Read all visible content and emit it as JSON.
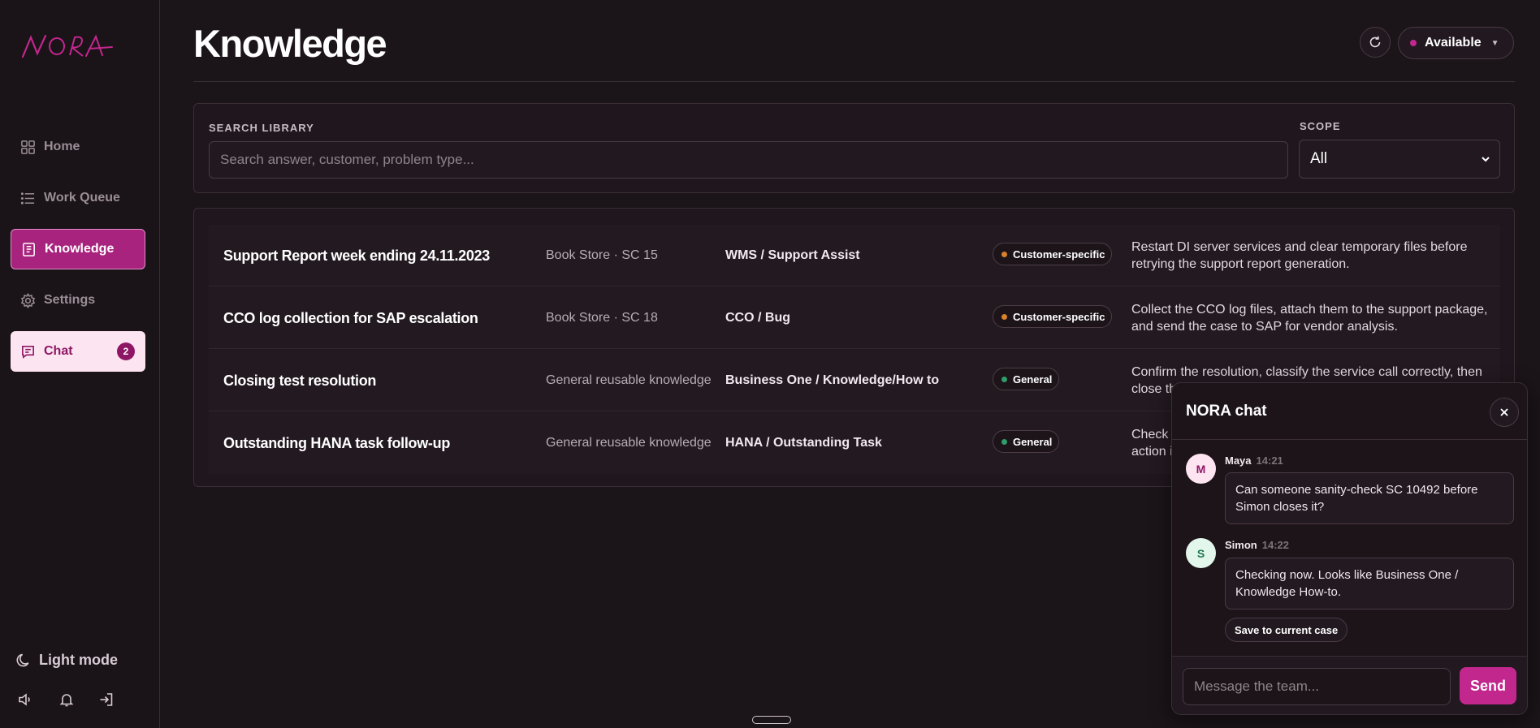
{
  "app": {
    "logo_text": "NORA"
  },
  "sidebar": {
    "items": [
      {
        "label": "Home",
        "icon": "grid-icon"
      },
      {
        "label": "Work Queue",
        "icon": "list-icon"
      },
      {
        "label": "Knowledge",
        "icon": "book-icon",
        "active": true
      },
      {
        "label": "Settings",
        "icon": "gear-icon"
      },
      {
        "label": "Chat",
        "icon": "chat-icon",
        "badge": "2"
      }
    ],
    "light_mode_label": "Light mode"
  },
  "header": {
    "title": "Knowledge",
    "status_label": "Available"
  },
  "search": {
    "label": "SEARCH LIBRARY",
    "placeholder": "Search answer, customer, problem type...",
    "scope_label": "SCOPE",
    "scope_value": "All"
  },
  "results": [
    {
      "title": "Support Report week ending 24.11.2023",
      "source": "Book Store · SC 15",
      "category": "WMS / Support Assist",
      "scope": "Customer-specific",
      "scope_color": "#d9822b",
      "description": "Restart DI server services and clear temporary files before retrying the support report generation."
    },
    {
      "title": "CCO log collection for SAP escalation",
      "source": "Book Store · SC 18",
      "category": "CCO / Bug",
      "scope": "Customer-specific",
      "scope_color": "#d9822b",
      "description": "Collect the CCO log files, attach them to the support package, and send the case to SAP for vendor analysis."
    },
    {
      "title": "Closing test resolution",
      "source": "General reusable knowledge",
      "category": "Business One / Knowledge/How to",
      "scope": "General",
      "scope_color": "#2f9d6a",
      "description": "Confirm the resolution, classify the service call correctly, then close th"
    },
    {
      "title": "Outstanding HANA task follow-up",
      "source": "General reusable knowledge",
      "category": "HANA / Outstanding Task",
      "scope": "General",
      "scope_color": "#2f9d6a",
      "description": "Check t action i"
    }
  ],
  "chat": {
    "title": "NORA chat",
    "messages": [
      {
        "initial": "M",
        "author": "Maya",
        "time": "14:21",
        "text": "Can someone sanity-check SC 10492 before Simon closes it?"
      },
      {
        "initial": "S",
        "author": "Simon",
        "time": "14:22",
        "text": "Checking now. Looks like Business One / Knowledge How-to."
      }
    ],
    "save_label": "Save to current case",
    "input_placeholder": "Message the team...",
    "send_label": "Send"
  },
  "colors": {
    "accent": "#c2278d",
    "background": "#1b1419"
  }
}
